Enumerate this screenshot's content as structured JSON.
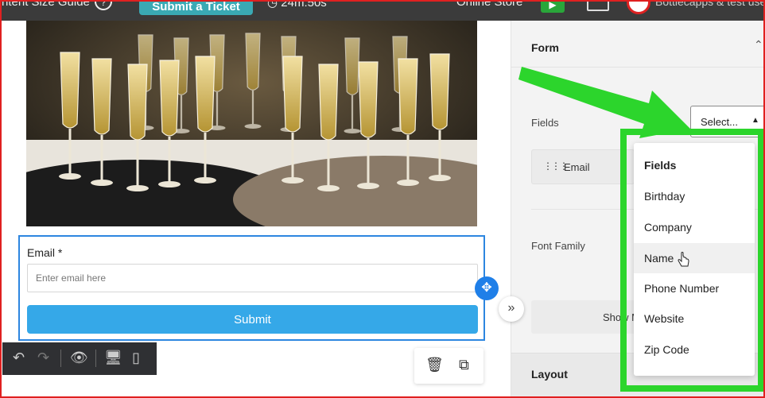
{
  "topbar": {
    "guide_text": "ntent Size Guide",
    "help_icon": "?",
    "ticket_label": "Submit a Ticket",
    "timer_text": "24m:50s",
    "store_label": "Online Store",
    "shop_name": "Bottlecapps & test use"
  },
  "canvas": {
    "form": {
      "email_label": "Email *",
      "email_placeholder": "Enter email here",
      "submit_label": "Submit"
    }
  },
  "panel": {
    "form_title": "Form",
    "fields_label": "Fields",
    "select_label": "Select...",
    "email_field": "Email",
    "font_family_label": "Font Family",
    "show_more_label": "Show M",
    "layout_title": "Layout"
  },
  "dropdown": {
    "header": "Fields",
    "options": [
      "Birthday",
      "Company",
      "Name",
      "Phone Number",
      "Website",
      "Zip Code"
    ],
    "hovered": "Name"
  },
  "colors": {
    "accent_blue": "#2d86e0",
    "submit_blue": "#35a8e8",
    "annotation_green": "#2cd52c",
    "ticket_teal": "#3aa9b4"
  }
}
